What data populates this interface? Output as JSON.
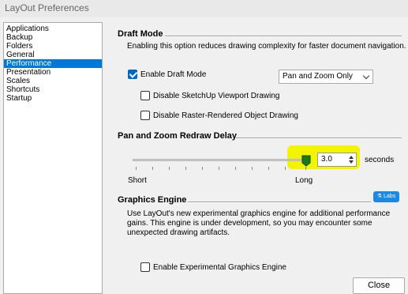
{
  "window": {
    "title": "LayOut Preferences"
  },
  "sidebar": {
    "items": [
      {
        "label": "Applications"
      },
      {
        "label": "Backup"
      },
      {
        "label": "Folders"
      },
      {
        "label": "General"
      },
      {
        "label": "Performance",
        "selected": true
      },
      {
        "label": "Presentation"
      },
      {
        "label": "Scales"
      },
      {
        "label": "Shortcuts"
      },
      {
        "label": "Startup"
      }
    ]
  },
  "draft_mode": {
    "title": "Draft Mode",
    "description": "Enabling this option reduces drawing complexity for faster document navigation.",
    "enable_label": "Enable Draft Mode",
    "enable_checked": true,
    "mode_selected": "Pan and Zoom Only",
    "disable_sketchup_label": "Disable SketchUp Viewport Drawing",
    "disable_sketchup_checked": false,
    "disable_raster_label": "Disable Raster-Rendered Object Drawing",
    "disable_raster_checked": false
  },
  "redraw_delay": {
    "title": "Pan and Zoom Redraw Delay",
    "value": "3.0",
    "unit": "seconds",
    "min_label": "Short",
    "max_label": "Long"
  },
  "graphics_engine": {
    "title": "Graphics Engine",
    "badge": "Labs",
    "description_line1": "Use LayOut's new experimental graphics engine for additional performance",
    "description_line2": "gains. This engine is under development, so you may encounter some",
    "description_line3": "unexpected drawing artifacts.",
    "enable_label": "Enable Experimental Graphics Engine",
    "enable_checked": false
  },
  "footer": {
    "close_label": "Close"
  },
  "colors": {
    "accent": "#0078d7",
    "highlight": "#f3f400",
    "thumb": "#1a7a1a",
    "labs_badge": "#1e88e5"
  },
  "icons": {
    "checkmark": "checkmark-icon",
    "dropdown": "chevron-down-icon",
    "spinner": "spinner-arrows-icon",
    "labs": "flask-icon"
  }
}
